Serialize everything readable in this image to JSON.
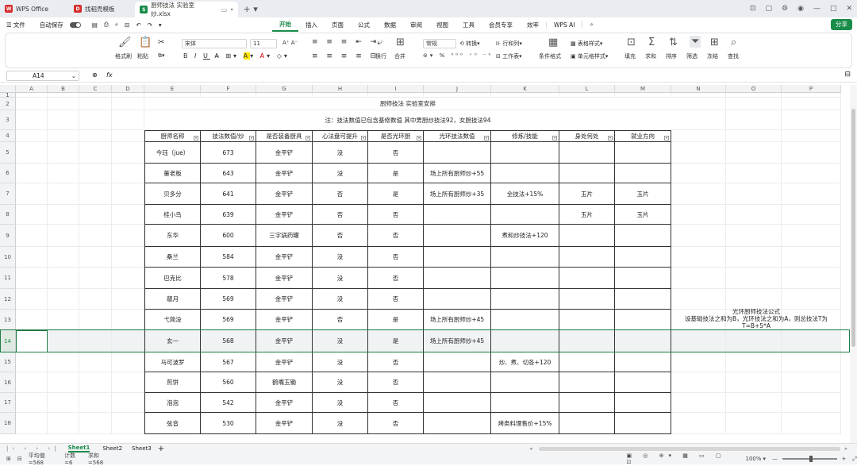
{
  "titlebar": {
    "tabs": [
      {
        "label": "WPS Office",
        "icon_color": "#d62d2d",
        "icon": "W"
      },
      {
        "label": "找稻壳模板",
        "icon_color": "#d62d2d",
        "icon": "D"
      },
      {
        "label": "厨师技法 实验室 炒.xlsx",
        "icon_color": "#1a8c4a",
        "icon": "S"
      }
    ],
    "right_icons": [
      "screen-icon",
      "window-icon",
      "settings-icon",
      "avatar-icon"
    ],
    "window_controls": [
      "—",
      "□",
      "✕"
    ]
  },
  "menubar": {
    "file": "文件",
    "autosave": "自动保存",
    "tabs": [
      "开始",
      "插入",
      "页面",
      "公式",
      "数据",
      "审阅",
      "视图",
      "工具",
      "会员专享",
      "效率",
      "WPS AI"
    ],
    "active_tab": "开始",
    "share": "分享"
  },
  "ribbon": {
    "format_painter": "格式刷",
    "paste": "粘贴",
    "font_name": "宋体",
    "font_size": "11",
    "wrap": "换行",
    "merge": "合并",
    "number_format": "常规",
    "convert": "转换",
    "row_col": "行和列",
    "worksheet": "工作表",
    "cond_format": "条件格式",
    "table_style": "表格样式",
    "cell_style": "单元格样式",
    "fill": "填充",
    "sum": "求和",
    "sort": "排序",
    "filter": "筛选",
    "freeze": "冻结",
    "find": "查找"
  },
  "formulabar": {
    "cell_ref": "A14",
    "fx": "fx",
    "value": ""
  },
  "columns": [
    "A",
    "B",
    "C",
    "D",
    "E",
    "F",
    "G",
    "H",
    "I",
    "J",
    "K",
    "L",
    "M",
    "N",
    "O",
    "P"
  ],
  "rows": [
    "1",
    "2",
    "3",
    "4",
    "5",
    "6",
    "7",
    "8",
    "9",
    "10",
    "11",
    "12",
    "13",
    "14",
    "15",
    "16",
    "17",
    "18"
  ],
  "sheet": {
    "title": "厨师技法 实验室安排",
    "note": "注：技法数值已包含基修数值 其中男厨炒技法92，女厨技法94",
    "headers": [
      "厨师名称",
      "技法数值/炒",
      "是否装备厨具",
      "心法盘可提升",
      "是否光环厨",
      "光环技法数值",
      "修炼/技能",
      "身处何处",
      "就业方向"
    ],
    "data": [
      [
        "今珏（jue）",
        "673",
        "金平铲",
        "没",
        "否",
        "",
        "",
        "",
        ""
      ],
      [
        "董老板",
        "643",
        "金平铲",
        "没",
        "是",
        "场上所有厨师炒+55",
        "",
        "",
        ""
      ],
      [
        "贝多分",
        "641",
        "金平铲",
        "否",
        "是",
        "场上所有厨师炒+35",
        "全技法+15%",
        "玉片",
        "玉片"
      ],
      [
        "桂小鸟",
        "639",
        "金平铲",
        "否",
        "否",
        "",
        "",
        "玉片",
        "玉片"
      ],
      [
        "东华",
        "600",
        "三字锅药罐",
        "否",
        "否",
        "",
        "煮和炒技法+120",
        "",
        ""
      ],
      [
        "桑兰",
        "584",
        "金平铲",
        "没",
        "否",
        "",
        "",
        "",
        ""
      ],
      [
        "巴克比",
        "578",
        "金平铲",
        "没",
        "否",
        "",
        "",
        "",
        ""
      ],
      [
        "靓月",
        "569",
        "金平铲",
        "没",
        "否",
        "",
        "",
        "",
        ""
      ],
      [
        "弋简没",
        "569",
        "金平铲",
        "否",
        "是",
        "场上所有厨师炒+45",
        "",
        "",
        ""
      ],
      [
        "玄一",
        "568",
        "金平铲",
        "没",
        "是",
        "场上所有厨师炒+45",
        "",
        "",
        ""
      ],
      [
        "马可波罗",
        "567",
        "金平铲",
        "没",
        "否",
        "",
        "炒、煮、切各+120",
        "",
        ""
      ],
      [
        "煎饼",
        "560",
        "鹤嘴玉锄",
        "没",
        "否",
        "",
        "",
        "",
        ""
      ],
      [
        "泡泡",
        "542",
        "金平铲",
        "没",
        "否",
        "",
        "",
        "",
        ""
      ],
      [
        "弦音",
        "530",
        "金平铲",
        "没",
        "否",
        "",
        "烤类料理售价+15%",
        "",
        ""
      ]
    ],
    "formula_note": [
      "光环厨师技法公式",
      "设基础技法之和为B，光环技法之和为A，则总技法T为",
      "T=B+5*A"
    ]
  },
  "sheet_tabs": [
    "Sheet1",
    "Sheet2",
    "Sheet3"
  ],
  "active_sheet": "Sheet1",
  "status": {
    "average": "平均值=568",
    "count": "计数=6",
    "sum": "求和=568",
    "zoom": "100%"
  },
  "colors": {
    "accent": "#1a8c4a",
    "selection": "#1e7b45",
    "header_bg": "#f1f3f5"
  }
}
